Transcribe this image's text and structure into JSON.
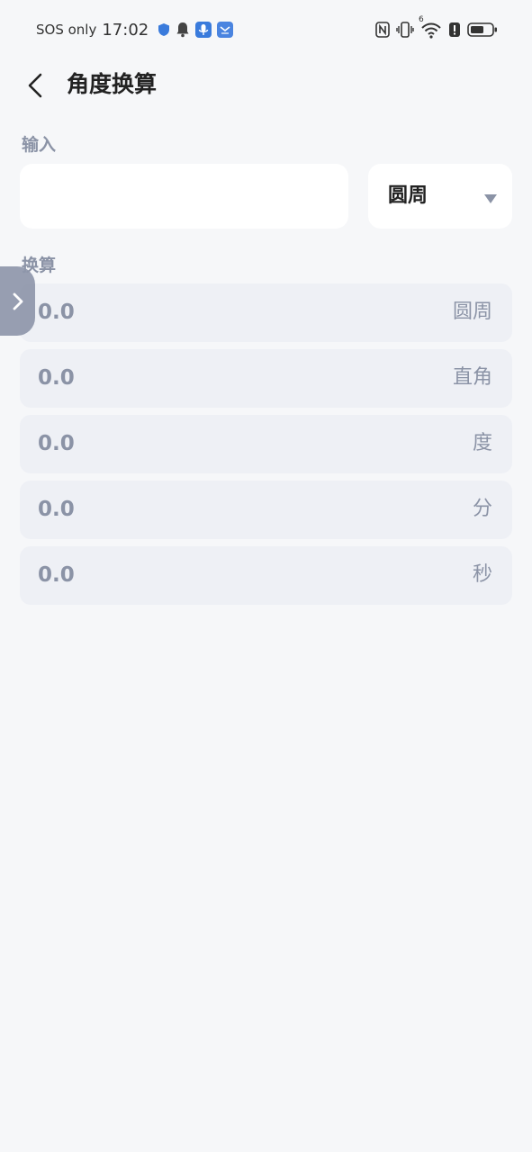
{
  "status_bar": {
    "carrier": "SOS only",
    "time": "17:02",
    "icons_left": [
      "shield-icon",
      "bell-icon",
      "mic-app-icon",
      "mail-app-icon"
    ],
    "icons_right": [
      "nfc-icon",
      "vibrate-icon",
      "wifi-icon",
      "alert-icon",
      "battery-icon"
    ],
    "wifi_label": "6"
  },
  "header": {
    "title": "角度换算"
  },
  "input_section": {
    "label": "输入",
    "value": "",
    "unit_selected": "圆周"
  },
  "convert_section": {
    "label": "换算",
    "rows": [
      {
        "value": "0.0",
        "unit": "圆周"
      },
      {
        "value": "0.0",
        "unit": "直角"
      },
      {
        "value": "0.0",
        "unit": "度"
      },
      {
        "value": "0.0",
        "unit": "分"
      },
      {
        "value": "0.0",
        "unit": "秒"
      }
    ]
  },
  "colors": {
    "background": "#f6f7f9",
    "card": "#ffffff",
    "row": "#eef0f5",
    "muted_text": "#8b93a6",
    "side_tab": "#8f97ab",
    "accent_blue": "#3a7bdc"
  }
}
